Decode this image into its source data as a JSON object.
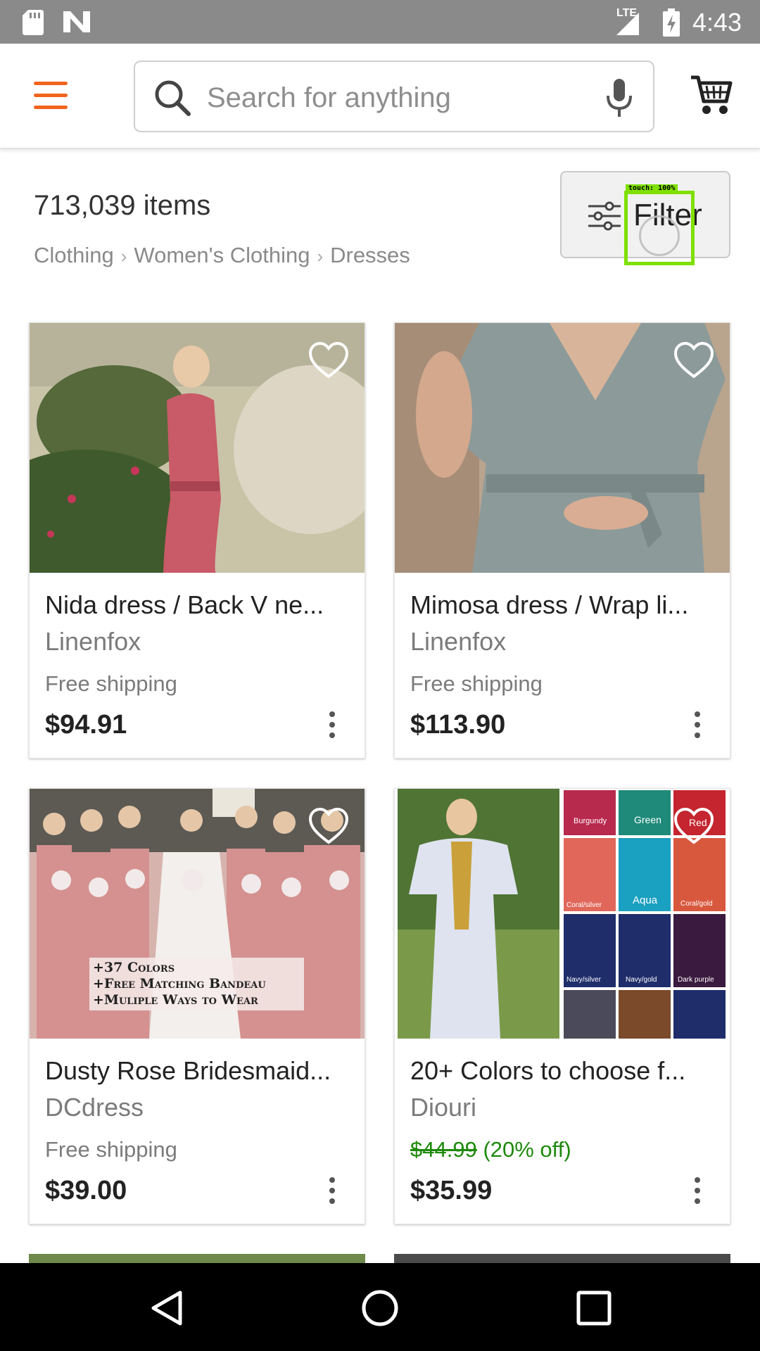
{
  "status_bar": {
    "time": "4:43",
    "network": "LTE",
    "icons": [
      "sd-card-icon",
      "n-logo-icon",
      "signal-icon",
      "battery-charging-icon"
    ]
  },
  "header": {
    "search_placeholder": "Search for anything",
    "search_value": "",
    "icons": [
      "menu-icon",
      "search-icon",
      "mic-icon",
      "cart-icon"
    ],
    "accent_color": "#f1641e"
  },
  "results": {
    "count": "713,039 items",
    "breadcrumb": [
      "Clothing",
      "Women's Clothing",
      "Dresses"
    ],
    "filter_label": "Filter"
  },
  "touch_overlay": {
    "label": "touch: 100%",
    "color": "#7fe000"
  },
  "listings": [
    {
      "title": "Nida dress / Back V ne...",
      "shop": "Linenfox",
      "shipping": "Free shipping",
      "price": "$94.91"
    },
    {
      "title": "Mimosa dress / Wrap li...",
      "shop": "Linenfox",
      "shipping": "Free shipping",
      "price": "$113.90"
    },
    {
      "title": "Dusty Rose Bridesmaid...",
      "shop": "DCdress",
      "shipping": "Free shipping",
      "price": "$39.00",
      "image_text": [
        "+37 Colors",
        "+Free Matching Bandeau",
        "+Muliple Ways to Wear"
      ]
    },
    {
      "title": "20+ Colors to choose f...",
      "shop": "Diouri",
      "original_price": "$44.99",
      "discount": "(20% off)",
      "price": "$35.99",
      "sale_color": "#1e8a0c",
      "image_text": [
        "Burgundy",
        "Green",
        "Red",
        "Coral/silver",
        "Aqua",
        "Coral/gold",
        "Navy/silver",
        "Navy/gold",
        "Dark purple"
      ]
    }
  ],
  "nav_bar": {
    "icons": [
      "back-icon",
      "home-icon",
      "recents-icon"
    ]
  }
}
